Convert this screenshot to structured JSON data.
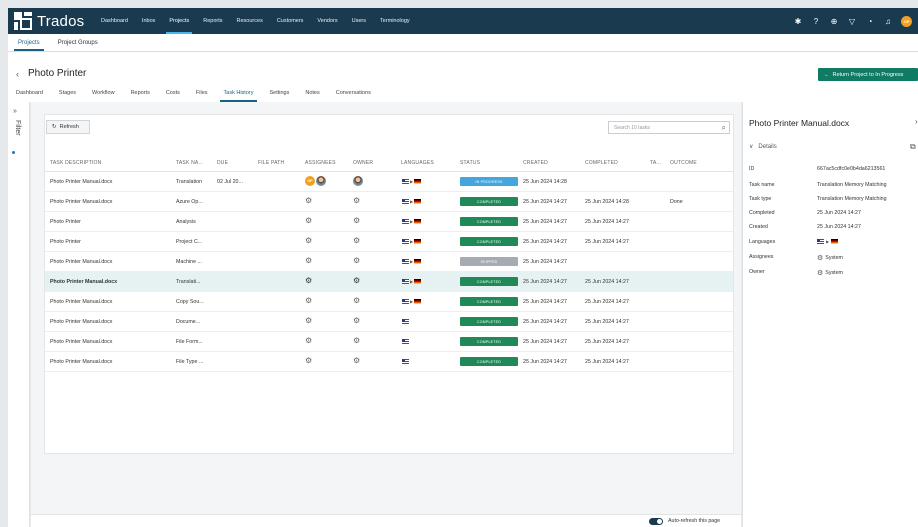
{
  "app": {
    "name": "Trados",
    "nav": [
      "Dashboard",
      "Inbox",
      "Projects",
      "Reports",
      "Resources",
      "Customers",
      "Vendors",
      "Users",
      "Terminology"
    ],
    "active_nav": "Projects",
    "user_initials": "OP"
  },
  "subtabs": [
    "Projects",
    "Project Groups"
  ],
  "project": {
    "title": "Photo Printer",
    "return_button": "Return Project to In Progress",
    "tabs": [
      "Dashboard",
      "Stages",
      "Workflow",
      "Reports",
      "Costs",
      "Files",
      "Task History",
      "Settings",
      "Notes",
      "Conversations"
    ],
    "active_tab": "Task History"
  },
  "filter": {
    "label": "Filter"
  },
  "toolbar": {
    "refresh": "Refresh",
    "search_placeholder": "Search 10 tasks"
  },
  "table": {
    "headers": [
      "TASK DESCRIPTION",
      "TASK NA...",
      "DUE",
      "FILE PATH",
      "ASSIGNEES",
      "OWNER",
      "LANGUAGES",
      "STATUS",
      "CREATED",
      "COMPLETED",
      "TA...",
      "OUTCOME"
    ],
    "rows": [
      {
        "desc": "Photo Printer Manual.docx",
        "name": "Translation",
        "due": "02 Jul 20...",
        "assignee": "user",
        "owner": "photo",
        "langs": "pair",
        "status": "IN PROGRESS",
        "status_key": "inprogress",
        "created": "25 Jun 2024 14:28",
        "completed": "",
        "outcome": ""
      },
      {
        "desc": "Photo Printer Manual.docx",
        "name": "Azure Op...",
        "due": "",
        "assignee": "system",
        "owner": "system",
        "langs": "pair",
        "status": "COMPLETED",
        "status_key": "completed",
        "created": "25 Jun 2024 14:27",
        "completed": "25 Jun 2024 14:28",
        "outcome": "Done"
      },
      {
        "desc": "Photo Printer",
        "name": "Analysis",
        "due": "",
        "assignee": "system",
        "owner": "system",
        "langs": "pair",
        "status": "COMPLETED",
        "status_key": "completed",
        "created": "25 Jun 2024 14:27",
        "completed": "25 Jun 2024 14:27",
        "outcome": ""
      },
      {
        "desc": "Photo Printer",
        "name": "Project C...",
        "due": "",
        "assignee": "system",
        "owner": "system",
        "langs": "pair",
        "status": "COMPLETED",
        "status_key": "completed",
        "created": "25 Jun 2024 14:27",
        "completed": "25 Jun 2024 14:27",
        "outcome": ""
      },
      {
        "desc": "Photo Printer Manual.docx",
        "name": "Machine ...",
        "due": "",
        "assignee": "system",
        "owner": "system",
        "langs": "pair",
        "status": "SKIPPED",
        "status_key": "skipped",
        "created": "25 Jun 2024 14:27",
        "completed": "",
        "outcome": ""
      },
      {
        "desc": "Photo Printer Manual.docx",
        "name": "Translati...",
        "due": "",
        "assignee": "system-dark",
        "owner": "system-dark",
        "langs": "pair",
        "status": "COMPLETED",
        "status_key": "completed",
        "created": "25 Jun 2024 14:27",
        "completed": "25 Jun 2024 14:27",
        "outcome": "",
        "selected": true
      },
      {
        "desc": "Photo Printer Manual.docx",
        "name": "Copy Sou...",
        "due": "",
        "assignee": "system",
        "owner": "system",
        "langs": "pair",
        "status": "COMPLETED",
        "status_key": "completed",
        "created": "25 Jun 2024 14:27",
        "completed": "25 Jun 2024 14:27",
        "outcome": ""
      },
      {
        "desc": "Photo Printer Manual.docx",
        "name": "Docume...",
        "due": "",
        "assignee": "system",
        "owner": "system",
        "langs": "source",
        "status": "COMPLETED",
        "status_key": "completed",
        "created": "25 Jun 2024 14:27",
        "completed": "25 Jun 2024 14:27",
        "outcome": ""
      },
      {
        "desc": "Photo Printer Manual.docx",
        "name": "File Form...",
        "due": "",
        "assignee": "system",
        "owner": "system",
        "langs": "source",
        "status": "COMPLETED",
        "status_key": "completed",
        "created": "25 Jun 2024 14:27",
        "completed": "25 Jun 2024 14:27",
        "outcome": ""
      },
      {
        "desc": "Photo Printer Manual.docx",
        "name": "File Type ...",
        "due": "",
        "assignee": "system",
        "owner": "system",
        "langs": "source",
        "status": "COMPLETED",
        "status_key": "completed",
        "created": "25 Jun 2024 14:27",
        "completed": "25 Jun 2024 14:27",
        "outcome": ""
      }
    ]
  },
  "footer": {
    "auto_refresh": "Auto-refresh this page"
  },
  "details": {
    "title": "Photo Printer Manual.docx",
    "section": "Details",
    "fields": [
      {
        "k": "ID",
        "v": "667ac5cdfc0e0b4da6213561"
      },
      {
        "k": "Task name",
        "v": "Translation Memory Matching"
      },
      {
        "k": "Task type",
        "v": "Translation Memory Matching"
      },
      {
        "k": "Completed",
        "v": "25 Jun 2024 14:27"
      },
      {
        "k": "Created",
        "v": "25 Jun 2024 14:27"
      },
      {
        "k": "Languages",
        "v": ""
      },
      {
        "k": "Assignees",
        "v": "System"
      },
      {
        "k": "Owner",
        "v": "System"
      }
    ]
  },
  "colors": {
    "topbar": "#1a3b4f",
    "accent": "#1a5f86",
    "completed": "#1f8a58",
    "inprogress": "#43a6dc",
    "skipped": "#a5abb0",
    "return_button": "#117a63"
  },
  "icons": {
    "gear": "gear-icon",
    "refresh": "refresh-icon",
    "search": "search-icon"
  }
}
